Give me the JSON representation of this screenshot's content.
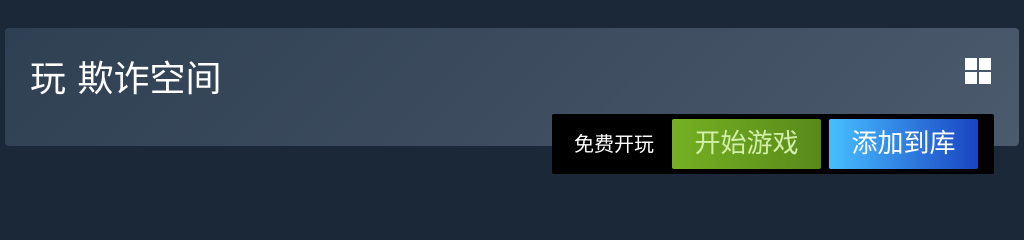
{
  "game": {
    "title": "玩 欺诈空间",
    "platform_icon": "windows-icon"
  },
  "purchase": {
    "price_label": "免费开玩",
    "play_button": "开始游戏",
    "library_button": "添加到库"
  },
  "colors": {
    "page_background": "#1b2838",
    "panel_gradient_start": "#2f4053",
    "panel_gradient_end": "#4b5b6d",
    "purchase_bar": "#000000",
    "play_button_start": "#75b022",
    "play_button_end": "#588a1b",
    "library_button_start": "#47bfff",
    "library_button_end": "#1a44c2"
  }
}
